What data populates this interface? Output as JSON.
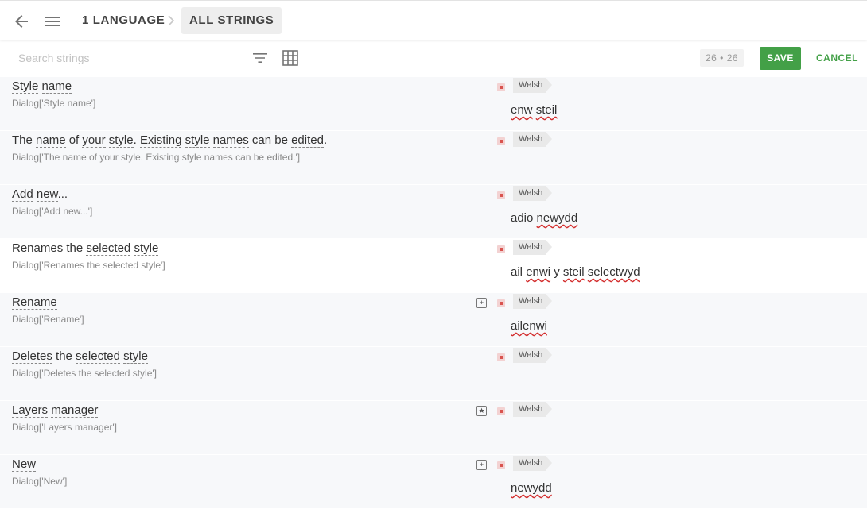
{
  "header": {
    "breadcrumb_1": "1 LANGUAGE",
    "breadcrumb_2": "ALL STRINGS"
  },
  "toolbar": {
    "search_placeholder": "Search strings",
    "counter": "26 • 26",
    "save_label": "SAVE",
    "cancel_label": "CANCEL"
  },
  "rows": [
    {
      "source_parts": [
        [
          "u",
          "Style"
        ],
        [
          "t",
          " "
        ],
        [
          "u",
          "name"
        ]
      ],
      "key": "Dialog['Style name']",
      "language": "Welsh",
      "translation_parts": [
        [
          "s",
          "enw"
        ],
        [
          "t",
          " "
        ],
        [
          "s",
          "steil"
        ]
      ],
      "extra_icon": "",
      "background": "alt"
    },
    {
      "source_parts": [
        [
          "t",
          "The "
        ],
        [
          "u",
          "name"
        ],
        [
          "t",
          " of "
        ],
        [
          "u",
          "your"
        ],
        [
          "t",
          " "
        ],
        [
          "u",
          "style"
        ],
        [
          "t",
          ". "
        ],
        [
          "u",
          "Existing"
        ],
        [
          "t",
          " "
        ],
        [
          "u",
          "style"
        ],
        [
          "t",
          " "
        ],
        [
          "u",
          "names"
        ],
        [
          "t",
          " can be "
        ],
        [
          "u",
          "edited"
        ],
        [
          "t",
          "."
        ]
      ],
      "key": "Dialog['The name of your style. Existing style names can be edited.']",
      "language": "Welsh",
      "translation_parts": [],
      "extra_icon": "",
      "background": "alt"
    },
    {
      "source_parts": [
        [
          "u",
          "Add"
        ],
        [
          "t",
          " "
        ],
        [
          "u",
          "new"
        ],
        [
          "t",
          "..."
        ]
      ],
      "key": "Dialog['Add new...']",
      "language": "Welsh",
      "translation_parts": [
        [
          "t",
          "adio "
        ],
        [
          "s",
          "newydd"
        ]
      ],
      "extra_icon": "",
      "background": "alt"
    },
    {
      "source_parts": [
        [
          "t",
          "Renames the "
        ],
        [
          "u",
          "selected"
        ],
        [
          "t",
          " "
        ],
        [
          "u",
          "style"
        ]
      ],
      "key": "Dialog['Renames the selected style']",
      "language": "Welsh",
      "translation_parts": [
        [
          "t",
          "ail "
        ],
        [
          "s",
          "enwi"
        ],
        [
          "t",
          " y "
        ],
        [
          "s",
          "steil"
        ],
        [
          "t",
          " "
        ],
        [
          "s",
          "selectwyd"
        ]
      ],
      "extra_icon": "",
      "background": "plain"
    },
    {
      "source_parts": [
        [
          "u",
          "Rename"
        ]
      ],
      "key": "Dialog['Rename']",
      "language": "Welsh",
      "translation_parts": [
        [
          "s",
          "ailenwi"
        ]
      ],
      "extra_icon": "expand-icon",
      "background": "alt"
    },
    {
      "source_parts": [
        [
          "u",
          "Deletes"
        ],
        [
          "t",
          " the "
        ],
        [
          "u",
          "selected"
        ],
        [
          "t",
          " "
        ],
        [
          "u",
          "style"
        ]
      ],
      "key": "Dialog['Deletes the selected style']",
      "language": "Welsh",
      "translation_parts": [],
      "extra_icon": "",
      "background": "alt"
    },
    {
      "source_parts": [
        [
          "u",
          "Layers"
        ],
        [
          "t",
          " "
        ],
        [
          "u",
          "manager"
        ]
      ],
      "key": "Dialog['Layers manager']",
      "language": "Welsh",
      "translation_parts": [],
      "extra_icon": "star-icon",
      "background": "alt"
    },
    {
      "source_parts": [
        [
          "u",
          "New"
        ]
      ],
      "key": "Dialog['New']",
      "language": "Welsh",
      "translation_parts": [
        [
          "s",
          "newydd"
        ]
      ],
      "extra_icon": "expand-icon",
      "background": "alt"
    }
  ]
}
